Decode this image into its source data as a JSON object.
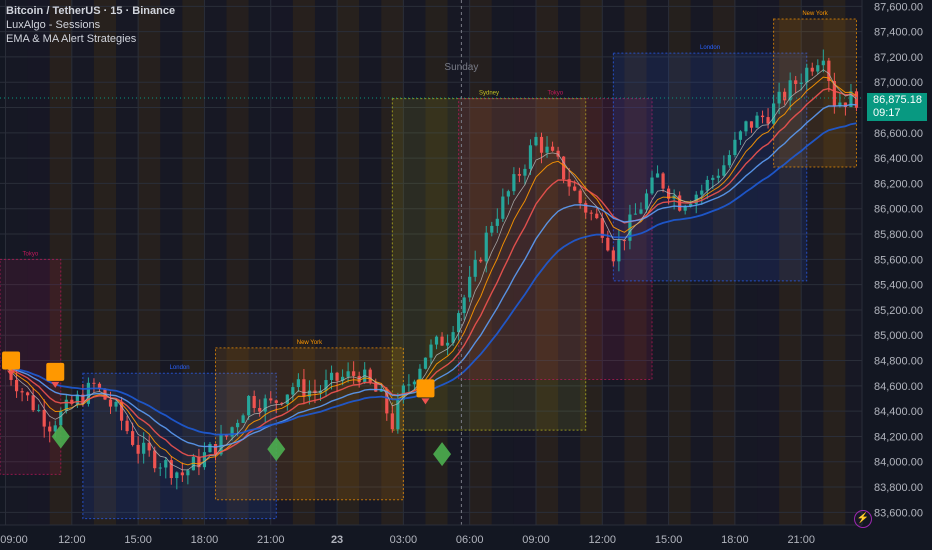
{
  "legend": {
    "title": "Bitcoin / TetherUS · 15 · Binance",
    "line2": "LuxAlgo - Sessions",
    "line3": "EMA & MA Alert Strategies"
  },
  "price_tag": {
    "price": "86,875.18",
    "countdown": "09:17"
  },
  "colors": {
    "background": "#131722",
    "up": "#26a69a",
    "down": "#ef5350",
    "sydney": "#c0c020",
    "tokyo": "#c2185b",
    "london": "#2962ff",
    "new_york": "#ff9800"
  },
  "chart_data": {
    "type": "candlestick",
    "title": "Bitcoin / TetherUS · 15 · Binance",
    "ylim": [
      83500,
      87650
    ],
    "y_ticks": [
      83600,
      83800,
      84000,
      84200,
      84400,
      84600,
      84800,
      85000,
      85200,
      85400,
      85600,
      85800,
      86000,
      86200,
      86400,
      86600,
      86800,
      87000,
      87200,
      87400,
      87600
    ],
    "y_tick_labels": [
      "83,600.00",
      "83,800.00",
      "84,000.00",
      "84,200.00",
      "84,400.00",
      "84,600.00",
      "84,800.00",
      "85,000.00",
      "85,200.00",
      "85,400.00",
      "85,600.00",
      "85,800.00",
      "86,000.00",
      "86,200.00",
      "86,400.00",
      "86,600.00",
      "86,800.00",
      "87,000.00",
      "87,200.00",
      "87,400.00",
      "87,600.00"
    ],
    "x_ticks": [
      {
        "t": 0,
        "label": "09:00"
      },
      {
        "t": 12,
        "label": "12:00"
      },
      {
        "t": 24,
        "label": "15:00"
      },
      {
        "t": 36,
        "label": "18:00"
      },
      {
        "t": 48,
        "label": "21:00"
      },
      {
        "t": 60,
        "label": "23"
      },
      {
        "t": 72,
        "label": "03:00"
      },
      {
        "t": 84,
        "label": "06:00"
      },
      {
        "t": 96,
        "label": "09:00"
      },
      {
        "t": 108,
        "label": "12:00"
      },
      {
        "t": 120,
        "label": "15:00"
      },
      {
        "t": 132,
        "label": "18:00"
      },
      {
        "t": 144,
        "label": "21:00"
      }
    ],
    "day_separator": {
      "t": 82.5,
      "label": "Sunday"
    },
    "last_price": 86875.18,
    "sessions": [
      {
        "name": "Tokyo",
        "kind": "tokyo",
        "t0": -1,
        "t1": 10,
        "low": 83900,
        "high": 85600
      },
      {
        "name": "London",
        "kind": "london",
        "t0": 14,
        "t1": 49,
        "low": 83550,
        "high": 84700
      },
      {
        "name": "New York",
        "kind": "new_york",
        "t0": 38,
        "t1": 72,
        "low": 83700,
        "high": 84900
      },
      {
        "name": "Sydney",
        "kind": "sydney",
        "t0": 70,
        "t1": 105,
        "low": 84250,
        "high": 86870
      },
      {
        "name": "Tokyo",
        "kind": "tokyo",
        "t0": 82,
        "t1": 117,
        "low": 84650,
        "high": 86870
      },
      {
        "name": "London",
        "kind": "london",
        "t0": 110,
        "t1": 145,
        "low": 85430,
        "high": 87230
      },
      {
        "name": "New York",
        "kind": "new_york",
        "t0": 139,
        "t1": 154,
        "low": 86330,
        "high": 87500
      }
    ],
    "anchors": [
      [
        0,
        84750
      ],
      [
        4,
        84500
      ],
      [
        8,
        84300
      ],
      [
        12,
        84450
      ],
      [
        16,
        84600
      ],
      [
        20,
        84400
      ],
      [
        24,
        84100
      ],
      [
        28,
        84000
      ],
      [
        32,
        83900
      ],
      [
        36,
        84050
      ],
      [
        40,
        84200
      ],
      [
        44,
        84500
      ],
      [
        48,
        84450
      ],
      [
        52,
        84600
      ],
      [
        56,
        84550
      ],
      [
        60,
        84650
      ],
      [
        64,
        84700
      ],
      [
        68,
        84500
      ],
      [
        70,
        84300
      ],
      [
        72,
        84550
      ],
      [
        76,
        84850
      ],
      [
        80,
        85000
      ],
      [
        84,
        85400
      ],
      [
        88,
        85900
      ],
      [
        92,
        86200
      ],
      [
        96,
        86550
      ],
      [
        100,
        86350
      ],
      [
        104,
        86050
      ],
      [
        108,
        85850
      ],
      [
        110,
        85650
      ],
      [
        114,
        85950
      ],
      [
        118,
        86250
      ],
      [
        122,
        86050
      ],
      [
        126,
        86150
      ],
      [
        130,
        86350
      ],
      [
        134,
        86650
      ],
      [
        138,
        86750
      ],
      [
        142,
        86950
      ],
      [
        146,
        87150
      ],
      [
        148,
        87250
      ],
      [
        150,
        86850
      ],
      [
        154,
        86875
      ]
    ],
    "signals": [
      {
        "t": 1,
        "price": 84800,
        "type": "sell-box"
      },
      {
        "t": 9,
        "price": 84710,
        "type": "sell-box"
      },
      {
        "t": 10,
        "price": 84200,
        "type": "buy-diamond"
      },
      {
        "t": 49,
        "price": 84100,
        "type": "buy-diamond"
      },
      {
        "t": 76,
        "price": 84580,
        "type": "sell-box"
      },
      {
        "t": 79,
        "price": 84060,
        "type": "buy-diamond"
      }
    ]
  }
}
